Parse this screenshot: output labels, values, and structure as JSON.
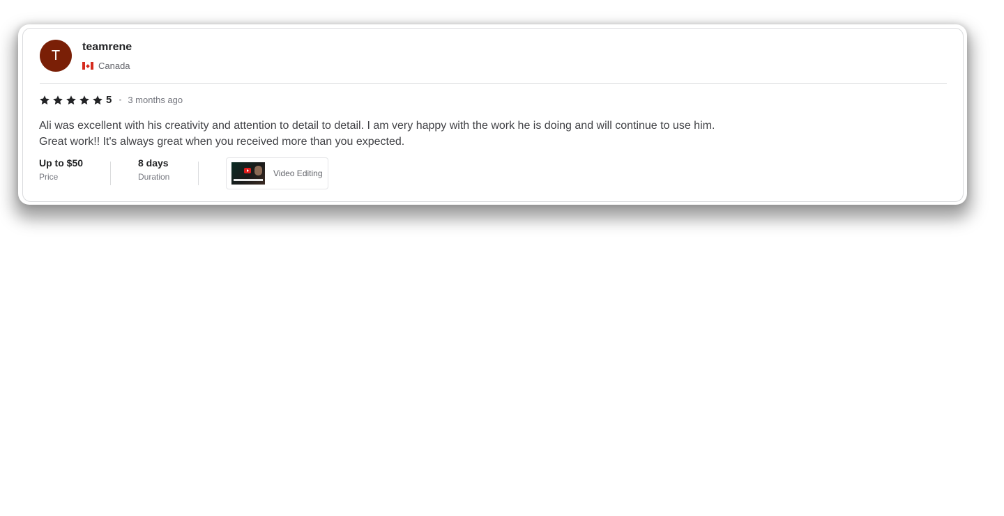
{
  "reviewer": {
    "avatar_initial": "T",
    "username": "teamrene",
    "country": "Canada",
    "flag_icon": "canada-flag-icon",
    "avatar_color": "#7a1f06"
  },
  "rating": {
    "stars": 5,
    "value": "5",
    "time_ago": "3 months ago"
  },
  "review": {
    "line1": "Ali was excellent with his creativity and attention to detail to detail. I am very happy with the work he is doing and will continue to use him.",
    "line2": "Great work!! It's always great when you received more than you expected."
  },
  "meta": {
    "price_value": "Up to $50",
    "price_label": "Price",
    "duration_value": "8 days",
    "duration_label": "Duration"
  },
  "gig": {
    "title": "Video Editing"
  }
}
